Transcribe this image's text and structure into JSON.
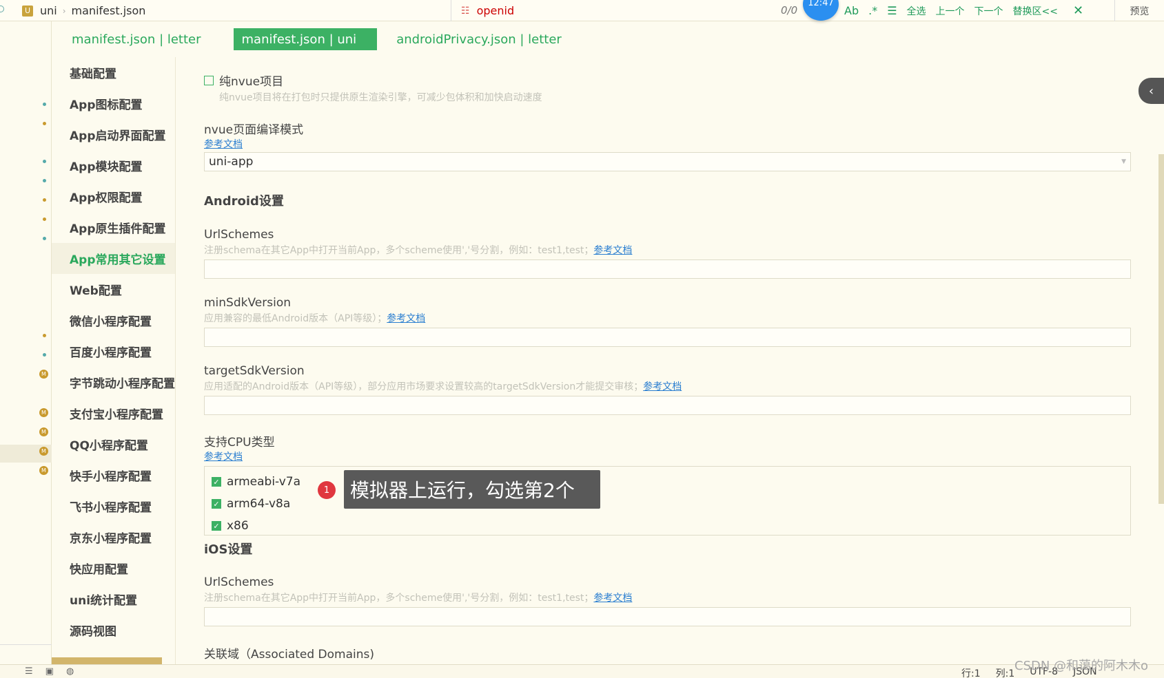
{
  "topbar": {
    "project": "uni",
    "file": "manifest.json",
    "find_query": "openid",
    "find_count": "0/0",
    "clock": "12:47",
    "select_all": "全选",
    "prev": "上一个",
    "next": "下一个",
    "replace": "替换区<<",
    "preview": "预览"
  },
  "tabs": [
    {
      "label": "manifest.json | letter"
    },
    {
      "label": "manifest.json | uni"
    },
    {
      "label": "androidPrivacy.json | letter"
    }
  ],
  "nav": [
    {
      "label": "基础配置"
    },
    {
      "label": "App图标配置"
    },
    {
      "label": "App启动界面配置"
    },
    {
      "label": "App模块配置"
    },
    {
      "label": "App权限配置"
    },
    {
      "label": "App原生插件配置"
    },
    {
      "label": "App常用其它设置"
    },
    {
      "label": "Web配置"
    },
    {
      "label": "微信小程序配置"
    },
    {
      "label": "百度小程序配置"
    },
    {
      "label": "字节跳动小程序配置"
    },
    {
      "label": "支付宝小程序配置"
    },
    {
      "label": "QQ小程序配置"
    },
    {
      "label": "快手小程序配置"
    },
    {
      "label": "飞书小程序配置"
    },
    {
      "label": "京东小程序配置"
    },
    {
      "label": "快应用配置"
    },
    {
      "label": "uni统计配置"
    },
    {
      "label": "源码视图"
    }
  ],
  "main": {
    "pure_nvue": {
      "label": "纯nvue项目",
      "hint": "纯nvue项目将在打包时只提供原生渲染引擎，可减少包体积和加快启动速度"
    },
    "nvue_mode": {
      "label": "nvue页面编译模式",
      "doc": "参考文档",
      "value": "uni-app"
    },
    "android_title": "Android设置",
    "url_schemes": {
      "label": "UrlSchemes",
      "hint": "注册schema在其它App中打开当前App，多个scheme使用','号分割，例如：test1,test；",
      "doc": "参考文档"
    },
    "min_sdk": {
      "label": "minSdkVersion",
      "hint": "应用兼容的最低Android版本（API等级）；",
      "doc": "参考文档"
    },
    "target_sdk": {
      "label": "targetSdkVersion",
      "hint": "应用适配的Android版本（API等级），部分应用市场要求设置较高的targetSdkVersion才能提交审核；",
      "doc": "参考文档"
    },
    "cpu": {
      "label": "支持CPU类型",
      "doc": "参考文档",
      "options": [
        {
          "label": "armeabi-v7a",
          "checked": true
        },
        {
          "label": "arm64-v8a",
          "checked": true
        },
        {
          "label": "x86",
          "checked": true
        }
      ]
    },
    "ios_title": "iOS设置",
    "ios_url_schemes": {
      "label": "UrlSchemes",
      "hint": "注册schema在其它App中打开当前App，多个scheme使用','号分割，例如：test1,test；",
      "doc": "参考文档"
    },
    "assoc_domains": {
      "label": "关联域（Associated Domains)"
    }
  },
  "annotation": {
    "badge": "1",
    "text": "模拟器上运行，勾选第2个"
  },
  "statusbar": {
    "line": "行:1",
    "col": "列:1",
    "encoding": "UTF-8",
    "lang": "JSON"
  },
  "watermark": "CSDN @和蔼的阿木木o",
  "colors": {
    "accent": "#3cb164",
    "link": "#2a7ed0",
    "background": "#fdfbef"
  }
}
